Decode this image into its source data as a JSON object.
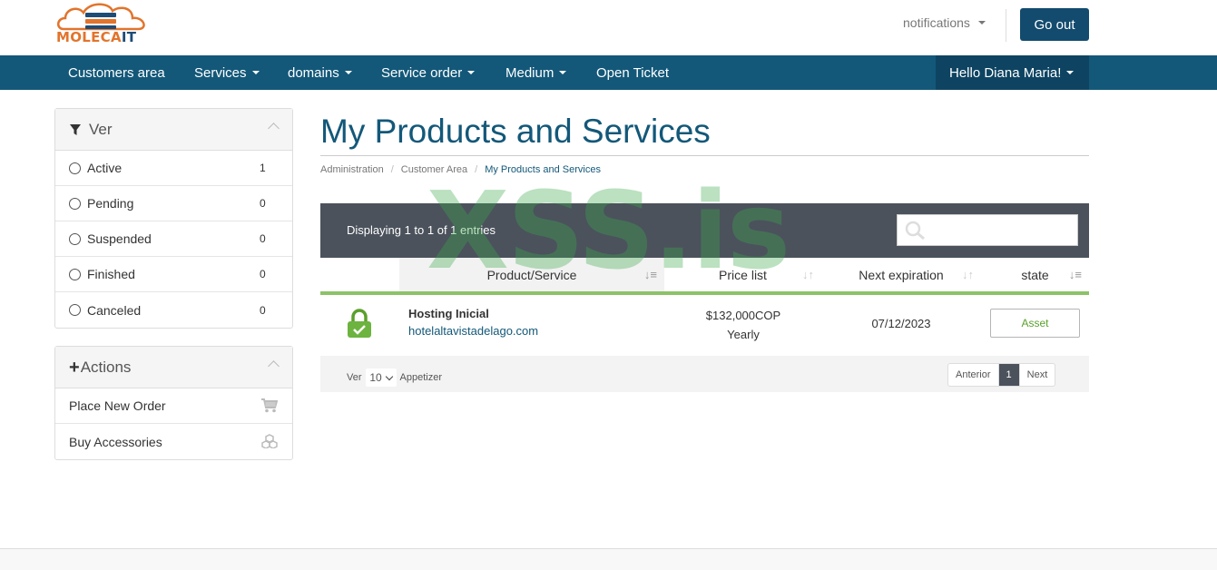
{
  "brand": {
    "logo_text": "MOLECAIT",
    "logo_part1": "MOLECA",
    "logo_part2": "IT"
  },
  "topbar": {
    "notifications": "notifications",
    "logout": "Go out"
  },
  "nav": {
    "items": [
      {
        "label": "Customers area"
      },
      {
        "label": "Services"
      },
      {
        "label": "domains"
      },
      {
        "label": "Service order"
      },
      {
        "label": "Medium"
      },
      {
        "label": "Open Ticket"
      }
    ],
    "user": "Hello Diana Maria!"
  },
  "sidebar": {
    "filter": {
      "title": "Ver",
      "items": [
        {
          "label": "Active",
          "count": "1"
        },
        {
          "label": "Pending",
          "count": "0"
        },
        {
          "label": "Suspended",
          "count": "0"
        },
        {
          "label": "Finished",
          "count": "0"
        },
        {
          "label": "Canceled",
          "count": "0"
        }
      ]
    },
    "actions": {
      "title": "Actions",
      "items": [
        {
          "label": "Place New Order",
          "icon": "cart-icon"
        },
        {
          "label": "Buy Accessories",
          "icon": "cubes-icon"
        }
      ]
    }
  },
  "page": {
    "title": "My Products and Services",
    "breadcrumb": [
      "Administration",
      "Customer Area",
      "My Products and Services"
    ]
  },
  "table": {
    "info": "Displaying 1 to 1 of 1 entries",
    "search_placeholder": "",
    "columns": [
      "Product/Service",
      "Price list",
      "Next expiration",
      "state"
    ],
    "rows": [
      {
        "product": "Hosting Inicial",
        "domain": "hotelaltavistadelago.com",
        "price": "$132,000COP",
        "cycle": "Yearly",
        "expiration": "07/12/2023",
        "status": "Asset"
      }
    ],
    "footer": {
      "show_label": "Ver",
      "page_size": "10",
      "entries_label": "Appetizer",
      "prev": "Anterior",
      "current_page": "1",
      "next": "Next"
    }
  },
  "watermark": "XSS.is",
  "colors": {
    "primary": "#135879",
    "accent_green": "#8dc268",
    "dark_bar": "#4b525c",
    "logo_orange": "#e2742c"
  }
}
